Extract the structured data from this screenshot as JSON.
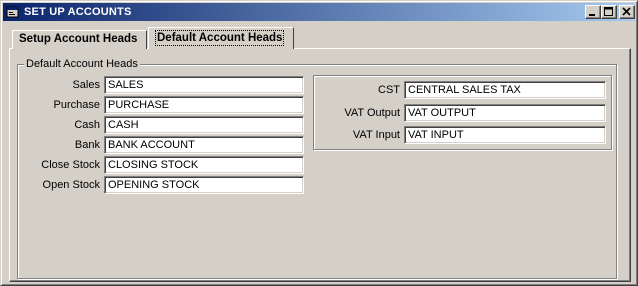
{
  "window": {
    "title": "SET UP ACCOUNTS"
  },
  "tabs": [
    {
      "label": "Setup Account Heads",
      "active": false
    },
    {
      "label": "Default Account Heads",
      "active": true
    }
  ],
  "group": {
    "legend": "Default Account Heads"
  },
  "left_fields": [
    {
      "label": "Sales",
      "value": "SALES"
    },
    {
      "label": "Purchase",
      "value": "PURCHASE"
    },
    {
      "label": "Cash",
      "value": "CASH"
    },
    {
      "label": "Bank",
      "value": "BANK ACCOUNT"
    },
    {
      "label": "Close Stock",
      "value": "CLOSING STOCK"
    },
    {
      "label": "Open Stock",
      "value": "OPENING STOCK"
    }
  ],
  "right_fields": [
    {
      "label": "CST",
      "value": "CENTRAL SALES TAX"
    },
    {
      "label": "VAT Output",
      "value": "VAT OUTPUT"
    },
    {
      "label": "VAT Input",
      "value": "VAT INPUT"
    }
  ],
  "icons": {
    "app": "app-icon",
    "minimize": "minimize-icon",
    "maximize": "maximize-icon",
    "close": "close-icon"
  },
  "colors": {
    "titlebar_start": "#0a246a",
    "titlebar_end": "#a6caf0",
    "face": "#d4d0c8"
  }
}
